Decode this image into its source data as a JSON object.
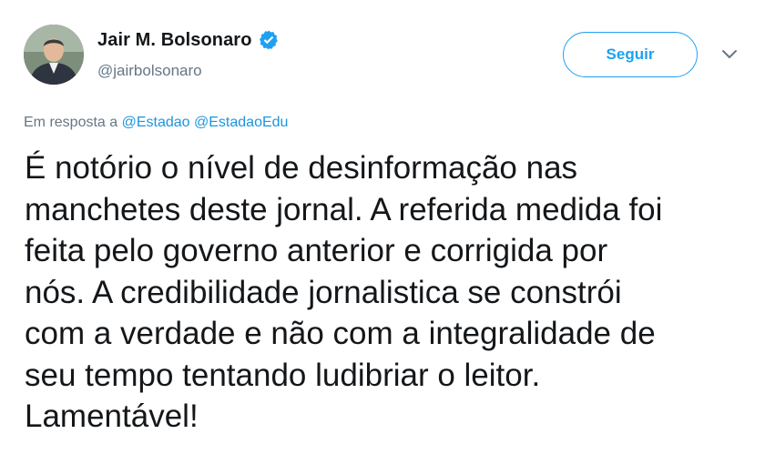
{
  "author": {
    "display_name": "Jair M. Bolsonaro",
    "handle": "@jairbolsonaro",
    "verified": true,
    "avatar_icon": "profile-photo"
  },
  "actions": {
    "follow_label": "Seguir",
    "more_icon": "chevron-down-icon"
  },
  "reply_context": {
    "prefix": "Em resposta a",
    "mentions": [
      "@Estadao",
      "@EstadaoEdu"
    ]
  },
  "tweet": {
    "lines": [
      "É notório o nível de desinformação nas",
      "manchetes deste jornal. A referida medida foi",
      "feita pelo governo anterior e corrigida por",
      "nós. A credibilidade jornalistica se constrói",
      "com a verdade e não com a integralidade de",
      "seu tempo tentando ludibriar o leitor.",
      "Lamentável!"
    ]
  },
  "colors": {
    "brand_blue": "#1da1f2",
    "mention_blue": "#1b95e0",
    "text_primary": "#14171a",
    "text_secondary": "#657786"
  }
}
